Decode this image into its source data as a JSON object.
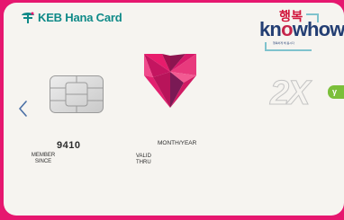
{
  "card": {
    "issuer": "KEB Hana Card",
    "brand_korean": "행복",
    "brand_word": [
      "kn",
      "o",
      "whow"
    ],
    "brand_small_text": "행복하게 해 봅시다",
    "multiplier": "2X",
    "tag": "γ",
    "card_number_fragment": "9410",
    "member_since_label": [
      "MEMBER",
      "SINCE"
    ],
    "validity_format": "MONTH/YEAR",
    "valid_thru_label": [
      "VALID",
      "THRU"
    ]
  },
  "icons": {
    "issuer_logo": "hana-logo-icon",
    "chip": "chip-icon",
    "heart": "heart-icon",
    "prev": "chevron-left-icon"
  },
  "colors": {
    "frame": "#e6176f",
    "card_background": "#f6f4f0",
    "issuer_teal": "#0f8a88",
    "brand_navy": "#233e73",
    "brand_red": "#d1153b",
    "tag_green": "#7bbf3a",
    "nav_arrow": "#4a6fa5"
  }
}
